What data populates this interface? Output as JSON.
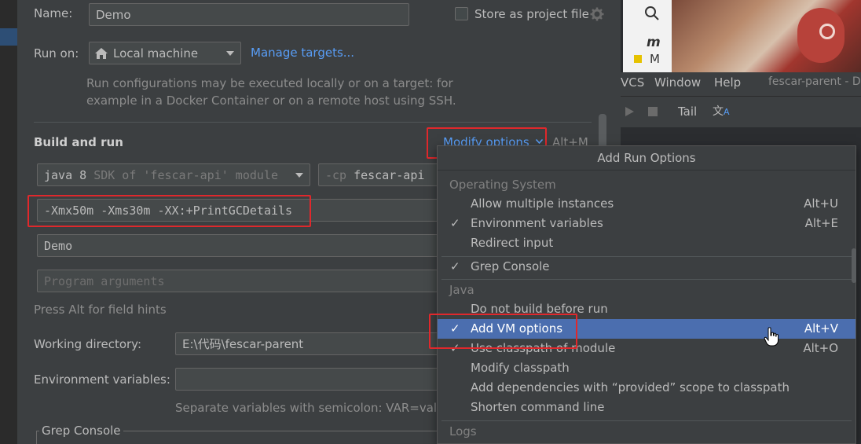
{
  "dialog": {
    "name_label": "Name:",
    "name_value": "Demo",
    "store_label": "Store as project file",
    "run_on_label": "Run on:",
    "run_on_value": "Local machine",
    "manage_targets": "Manage targets...",
    "run_on_help_1": "Run configurations may be executed locally or on a target: for",
    "run_on_help_2": "example in a Docker Container or on a remote host using SSH.",
    "build_run_title": "Build and run",
    "modify_options": "Modify options",
    "modify_shortcut": "Alt+M",
    "sdk_value_main": "java 8",
    "sdk_value_sub": "SDK of 'fescar-api' module",
    "cp_prefix": "-cp",
    "cp_value": "fescar-api",
    "vm_options": "-Xmx50m -Xms30m -XX:+PrintGCDetails",
    "main_class": "Demo",
    "program_args_placeholder": "Program arguments",
    "field_hints": "Press Alt for field hints",
    "working_dir_label": "Working directory:",
    "working_dir_value": "E:\\代码\\fescar-parent",
    "env_vars_label": "Environment variables:",
    "env_vars_help": "Separate variables with semicolon: VAR=value",
    "grep_console_group": "Grep Console"
  },
  "background_ide": {
    "menu": [
      "VCS",
      "Window",
      "Help"
    ],
    "project_title": "fescar-parent - D",
    "tail_label": "Tail"
  },
  "popup": {
    "title": "Add Run Options",
    "sections": {
      "os": "Operating System",
      "java": "Java",
      "logs": "Logs"
    },
    "os_items": [
      {
        "label": "Allow multiple instances",
        "checked": false,
        "shortcut": "Alt+U"
      },
      {
        "label": "Environment variables",
        "checked": true,
        "shortcut": "Alt+E"
      },
      {
        "label": "Redirect input",
        "checked": false,
        "shortcut": ""
      }
    ],
    "grep_item": {
      "label": "Grep Console",
      "checked": true
    },
    "java_items": [
      {
        "label": "Do not build before run",
        "checked": false,
        "shortcut": ""
      },
      {
        "label": "Add VM options",
        "checked": true,
        "shortcut": "Alt+V",
        "selected": true
      },
      {
        "label": "Use classpath of module",
        "checked": true,
        "shortcut": "Alt+O"
      },
      {
        "label": "Modify classpath",
        "checked": false,
        "shortcut": ""
      },
      {
        "label": "Add dependencies with “provided” scope to classpath",
        "checked": false,
        "shortcut": ""
      },
      {
        "label": "Shorten command line",
        "checked": false,
        "shortcut": ""
      }
    ]
  },
  "colors": {
    "background": "#3c3f41",
    "field_bg": "#45494a",
    "link": "#589df6",
    "selection": "#4b6eaf",
    "highlight_box": "#e0282c"
  },
  "icons": [
    "home-icon",
    "chevron-down-icon",
    "gear-icon",
    "search-icon",
    "checkmark-icon",
    "translate-icon",
    "stop-icon",
    "run-icon",
    "hand-cursor-icon"
  ]
}
